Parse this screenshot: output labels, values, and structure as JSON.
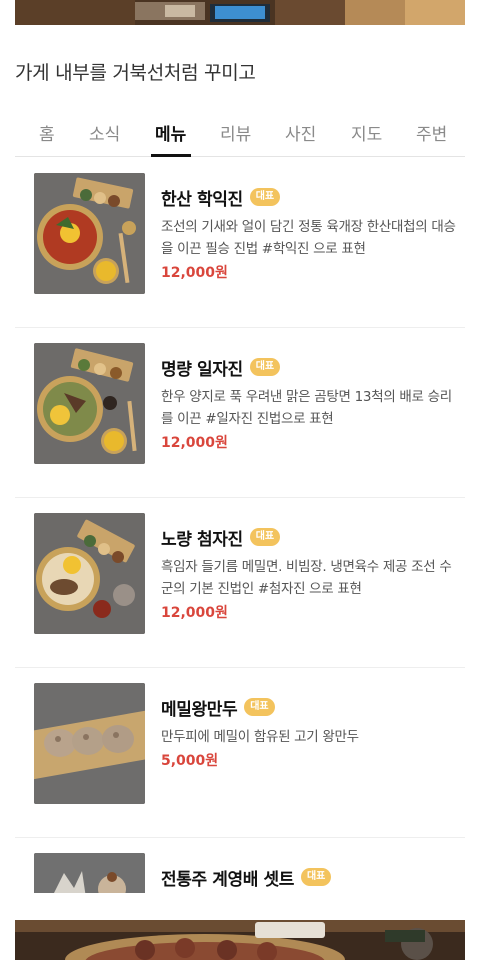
{
  "caption": "가게 내부를 거북선처럼 꾸미고",
  "tabs": [
    {
      "label": "홈",
      "active": false
    },
    {
      "label": "소식",
      "active": false
    },
    {
      "label": "메뉴",
      "active": true
    },
    {
      "label": "리뷰",
      "active": false
    },
    {
      "label": "사진",
      "active": false
    },
    {
      "label": "지도",
      "active": false
    },
    {
      "label": "주변",
      "active": false
    }
  ],
  "menu": [
    {
      "name": "한산 학익진",
      "badge": "대표",
      "desc": "조선의 기새와 얼이 담긴 정통 육개장 한산대첩의 대승을 이끈 필승 진법 #학익진 으로 표현",
      "price": "12,000원"
    },
    {
      "name": "명량 일자진",
      "badge": "대표",
      "desc": "한우 양지로 푹 우려낸 맑은 곰탕면 13척의 배로 승리를 이끈 #일자진 진법으로 표현",
      "price": "12,000원"
    },
    {
      "name": "노량 첨자진",
      "badge": "대표",
      "desc": "흑임자 들기름 메밀면. 비빔장. 냉면육수 제공 조선 수군의 기본 진법인 #첨자진 으로 표현",
      "price": "12,000원"
    },
    {
      "name": "메밀왕만두",
      "badge": "대표",
      "desc": "만두피에 메밀이 함유된 고기 왕만두",
      "price": "5,000원"
    },
    {
      "name": "전통주 계영배 셋트",
      "badge": "대표",
      "desc": "",
      "price": ""
    }
  ],
  "colors": {
    "accent_price": "#d9463c",
    "badge_bg": "#f3c35d",
    "active_tab": "#111111"
  },
  "icons": {
    "top_photo": "restaurant-interior-photo",
    "bottom_photo": "dish-photo"
  }
}
